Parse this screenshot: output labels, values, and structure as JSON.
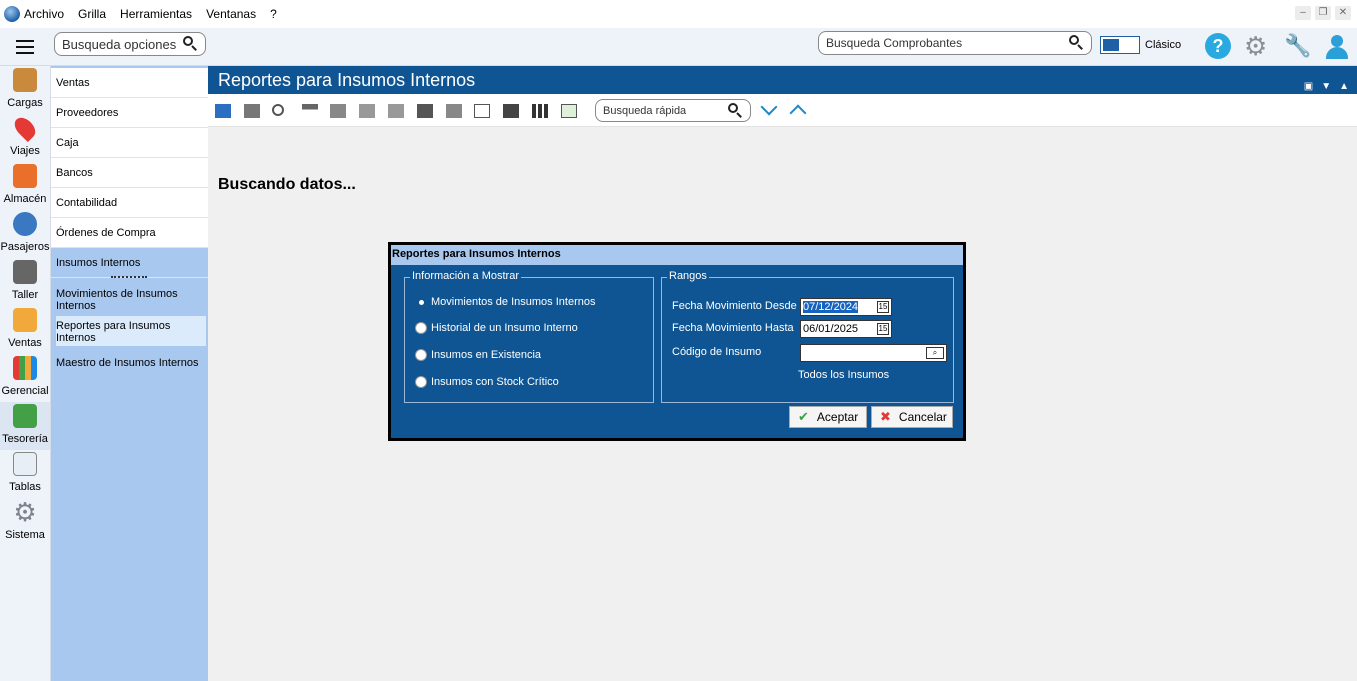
{
  "menu": [
    "Archivo",
    "Grilla",
    "Herramientas",
    "Ventanas",
    "?"
  ],
  "header": {
    "search_placeholder": "Busqueda opciones",
    "comp_placeholder": "Busqueda Comprobantes",
    "mode_label": "Clásico",
    "help": "?"
  },
  "nav": [
    {
      "label": "Cargas",
      "icon": "box-icon"
    },
    {
      "label": "Viajes",
      "icon": "map-pin-icon"
    },
    {
      "label": "Almacén",
      "icon": "warehouse-icon"
    },
    {
      "label": "Pasajeros",
      "icon": "passenger-icon"
    },
    {
      "label": "Taller",
      "icon": "tools-icon"
    },
    {
      "label": "Ventas",
      "icon": "sales-icon"
    },
    {
      "label": "Gerencial",
      "icon": "chart-icon"
    },
    {
      "label": "Tesorería",
      "icon": "money-icon"
    },
    {
      "label": "Tablas",
      "icon": "table-icon"
    },
    {
      "label": "Sistema",
      "icon": "gear-icon"
    }
  ],
  "submenu": [
    "Ventas",
    "Proveedores",
    "Caja",
    "Bancos",
    "Contabilidad",
    "Órdenes de Compra",
    "Insumos Internos"
  ],
  "subitems": [
    "Movimientos de Insumos Internos",
    "Reportes para Insumos Internos",
    "Maestro de Insumos Internos"
  ],
  "main": {
    "title": "Reportes para Insumos Internos",
    "quick_search": "Busqueda rápida",
    "status": "Buscando datos..."
  },
  "dialog": {
    "title": "Reportes para Insumos Internos",
    "info_legend": "Información a Mostrar",
    "options": [
      "Movimientos de Insumos Internos",
      "Historial de un Insumo Interno",
      "Insumos en Existencia",
      "Insumos con Stock Crítico"
    ],
    "selected_option": 0,
    "ranges_legend": "Rangos",
    "desde_label": "Fecha Movimiento Desde",
    "desde_value": "07/12/2024",
    "hasta_label": "Fecha Movimiento Hasta",
    "hasta_value": "06/01/2025",
    "codigo_label": "Código de Insumo",
    "codigo_value": "",
    "todos": "Todos los Insumos",
    "accept": "Aceptar",
    "cancel": "Cancelar"
  },
  "colors": {
    "accent": "#0f5593",
    "submenu": "#a9c8ef"
  }
}
